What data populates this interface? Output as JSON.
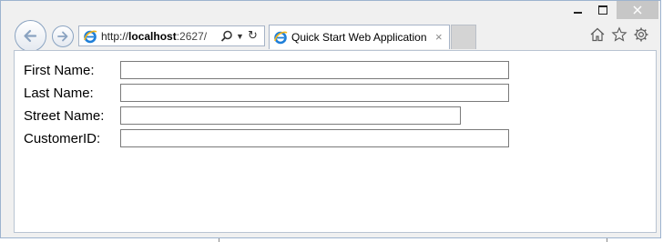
{
  "window": {
    "minimize_label": "Minimize",
    "maximize_label": "Maximize",
    "close_label": "Close"
  },
  "navigation": {
    "back_icon": "back-arrow-icon",
    "forward_icon": "forward-arrow-icon"
  },
  "address_bar": {
    "scheme": "http://",
    "host": "localhost",
    "rest": ":2627/",
    "search_icon": "magnifier-icon",
    "dropdown_icon": "chevron-down-icon",
    "refresh_icon": "refresh-icon"
  },
  "tab": {
    "title": "Quick Start Web Application",
    "close_glyph": "×"
  },
  "toolbar": {
    "home_icon": "home-icon",
    "favorites_icon": "star-icon",
    "tools_icon": "gear-icon"
  },
  "form": {
    "fields": [
      {
        "label": "First Name:",
        "value": ""
      },
      {
        "label": "Last Name:",
        "value": ""
      },
      {
        "label": "Street Name:",
        "value": ""
      },
      {
        "label": "CustomerID:",
        "value": ""
      }
    ]
  },
  "colors": {
    "window_border": "#9db3cf",
    "close_button": "#c7c7c7",
    "tab_border": "#a6b3c6"
  }
}
